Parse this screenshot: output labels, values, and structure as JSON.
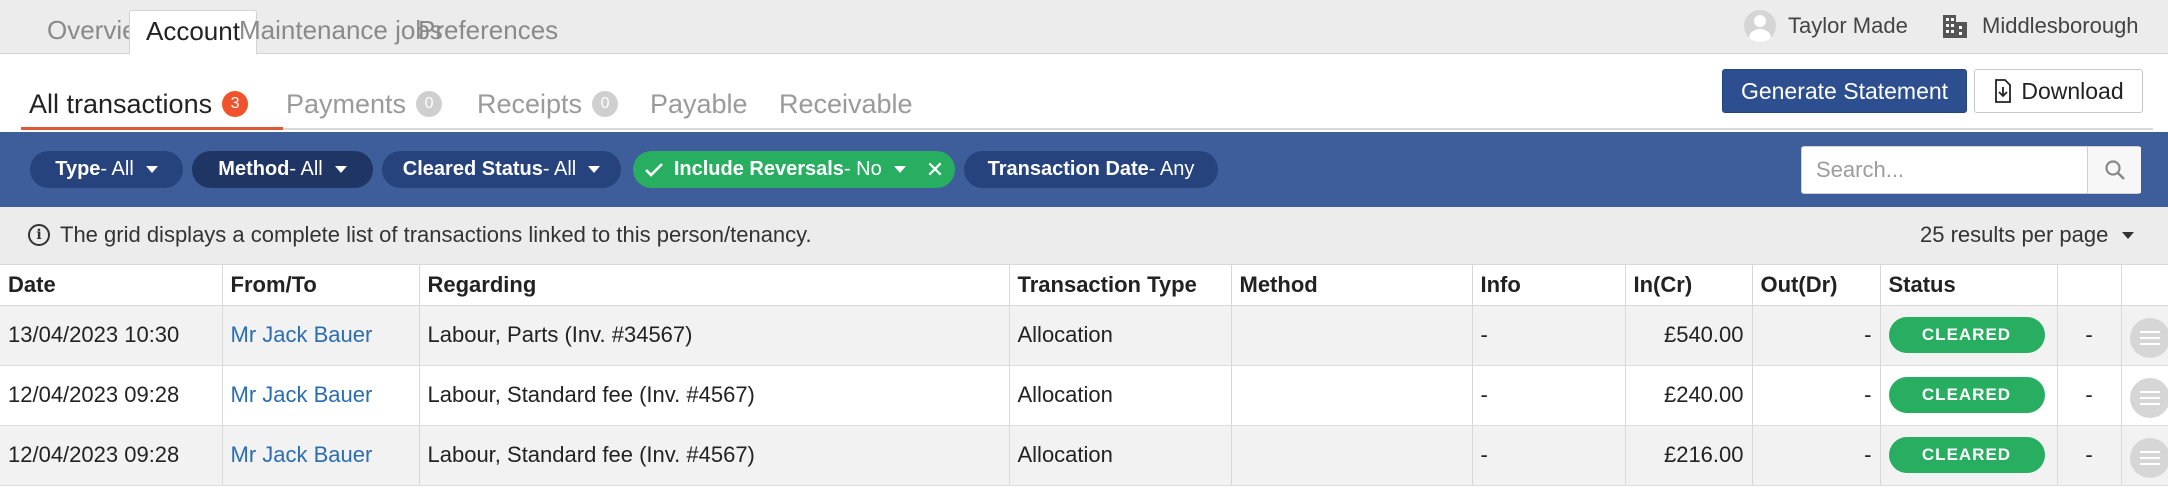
{
  "top_tabs": [
    {
      "label": "Overview"
    },
    {
      "label": "Account"
    },
    {
      "label": "Maintenance jobs"
    },
    {
      "label": "Preferences"
    }
  ],
  "user": {
    "name": "Taylor Made",
    "location": "Middlesborough"
  },
  "sub_tabs": [
    {
      "label": "All transactions",
      "count": "3"
    },
    {
      "label": "Payments",
      "count": "0"
    },
    {
      "label": "Receipts",
      "count": "0"
    },
    {
      "label": "Payable"
    },
    {
      "label": "Receivable"
    }
  ],
  "actions": {
    "generate": "Generate Statement",
    "download": "Download"
  },
  "filters": [
    {
      "name": "Type",
      "value": " - All"
    },
    {
      "name": "Method",
      "value": " - All"
    },
    {
      "name": "Cleared Status",
      "value": " - All"
    },
    {
      "name": "Include Reversals",
      "value": " - No"
    },
    {
      "name": "Transaction Date",
      "value": " - Any"
    }
  ],
  "search": {
    "placeholder": "Search..."
  },
  "info": {
    "text": "The grid displays a complete list of transactions linked to this person/tenancy.",
    "per_page": "25 results per page"
  },
  "columns": [
    "Date",
    "From/To",
    "Regarding",
    "Transaction Type",
    "Method",
    "Info",
    "In(Cr)",
    "Out(Dr)",
    "Status",
    "",
    ""
  ],
  "rows": [
    {
      "date": "13/04/2023 10:30",
      "from_to": "Mr Jack Bauer",
      "regarding": "Labour, Parts (Inv. #34567)",
      "type": "Allocation",
      "method": "",
      "info": "-",
      "in": "£540.00",
      "out": "-",
      "status": "CLEARED",
      "extra": "-"
    },
    {
      "date": "12/04/2023 09:28",
      "from_to": "Mr Jack Bauer",
      "regarding": "Labour, Standard fee (Inv. #4567)",
      "type": "Allocation",
      "method": "",
      "info": "-",
      "in": "£240.00",
      "out": "-",
      "status": "CLEARED",
      "extra": "-"
    },
    {
      "date": "12/04/2023 09:28",
      "from_to": "Mr Jack Bauer",
      "regarding": "Labour, Standard fee (Inv. #4567)",
      "type": "Allocation",
      "method": "",
      "info": "-",
      "in": "£216.00",
      "out": "-",
      "status": "CLEARED",
      "extra": "-"
    }
  ],
  "colors": {
    "brand_blue": "#3d5e9a",
    "primary_button": "#2e4f8f",
    "success_green": "#27ae60",
    "alert_red": "#f0522e",
    "link_blue": "#2a6db0"
  }
}
